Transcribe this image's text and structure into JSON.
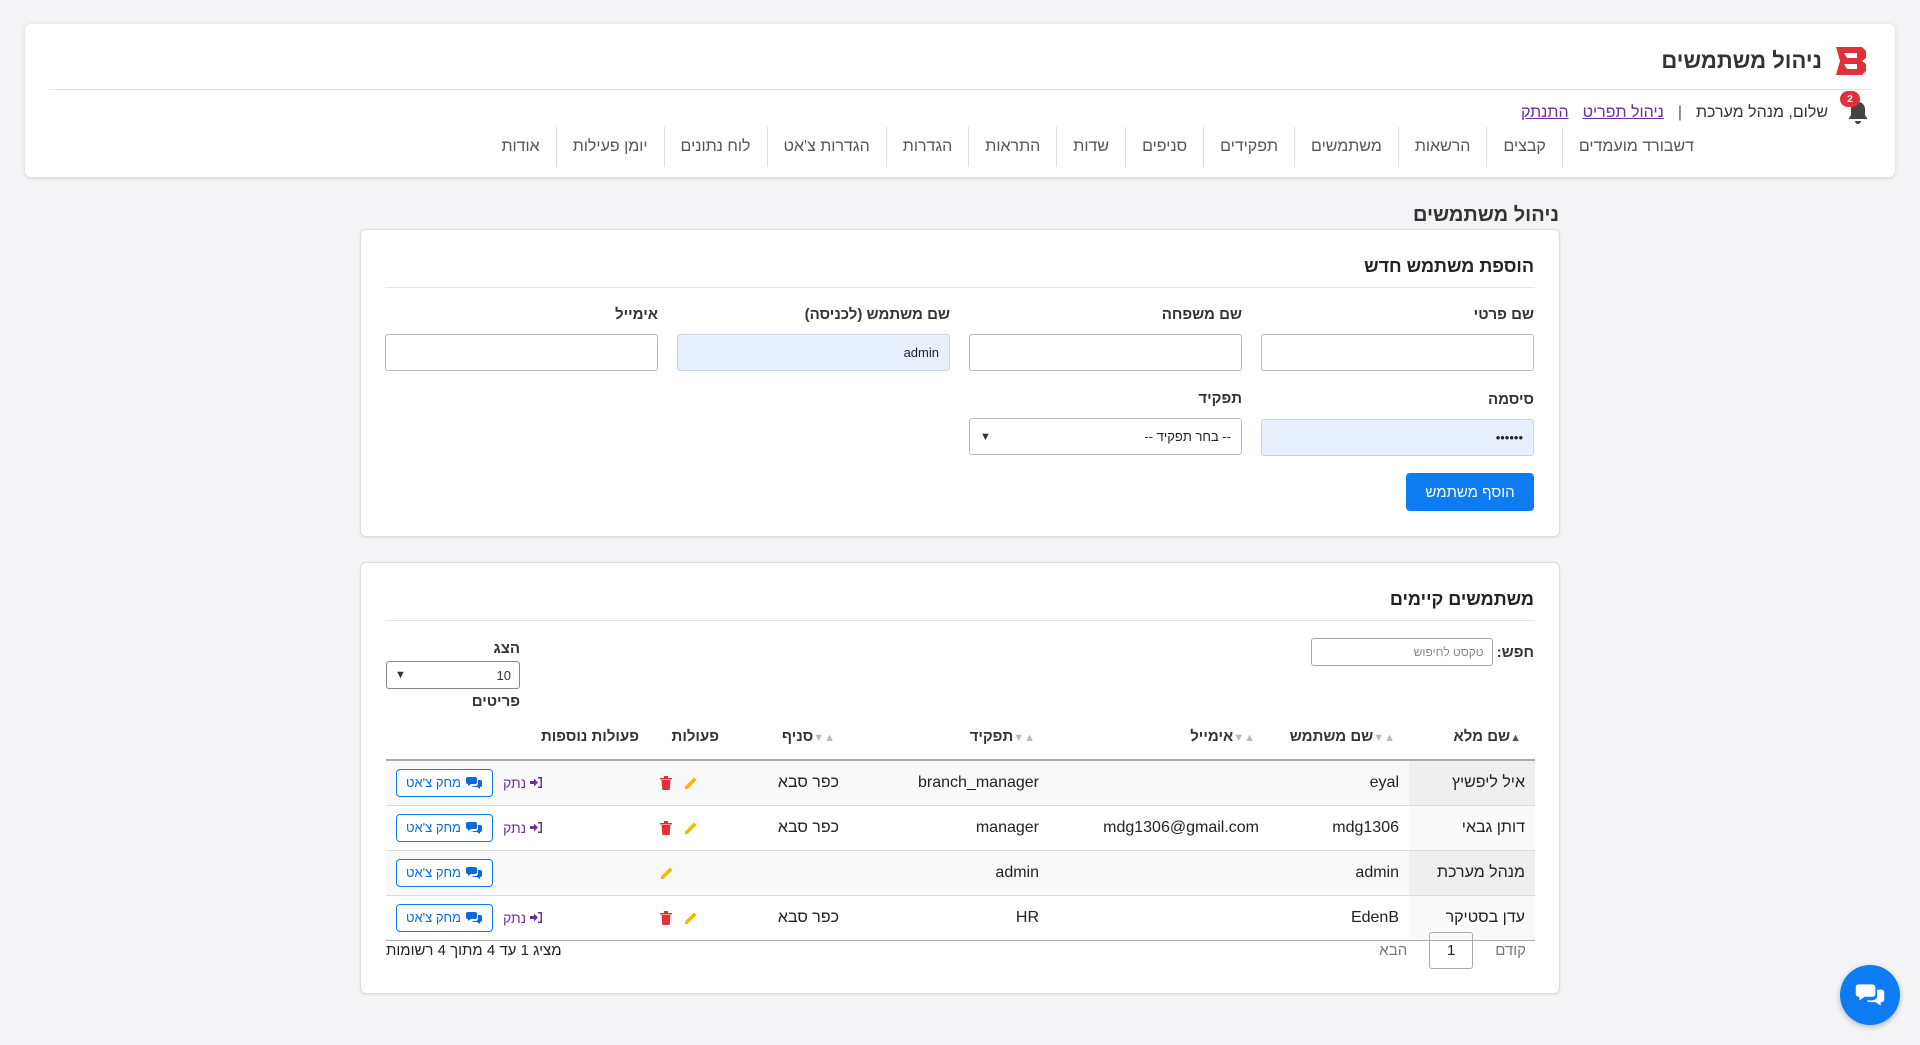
{
  "app": {
    "title": "ניהול משתמשים",
    "logo_text": "B",
    "brand_color": "#e0313b",
    "accent_color": "#0d7cf2"
  },
  "userbar": {
    "notification_count": "2",
    "greeting": "שלום, מנהל מערכת",
    "separator": "|",
    "profile_link": "ניהול תפריט",
    "logout_link": "התנתק"
  },
  "nav": {
    "items": [
      "דשבורד מועמדים",
      "קבצים",
      "הרשאות",
      "משתמשים",
      "תפקידים",
      "סניפים",
      "שדות",
      "התראות",
      "הגדרות",
      "הגדרות צ'אט",
      "לוח נתונים",
      "יומן פעילות",
      "אודות"
    ]
  },
  "page": {
    "title": "ניהול משתמשים"
  },
  "add_user": {
    "title": "הוספת משתמש חדש",
    "first_name_label": "שם פרטי",
    "first_name_value": "",
    "last_name_label": "שם משפחה",
    "last_name_value": "",
    "username_label": "שם משתמש (לכניסה)",
    "username_value": "admin",
    "email_label": "אימייל",
    "email_value": "",
    "password_label": "סיסמה",
    "password_value": "••••••",
    "role_label": "תפקיד",
    "role_value": "-- בחר תפקיד --",
    "submit_label": "הוסף משתמש"
  },
  "users": {
    "title": "משתמשים קיימים",
    "search_label": "חפש:",
    "search_placeholder": "טקסט לחיפוש",
    "length_label_top": "הצג",
    "length_value": "10",
    "length_label_bottom": "פריטים",
    "columns": {
      "full_name": "שם מלא",
      "username": "שם משתמש",
      "email": "אימייל",
      "role": "תפקיד",
      "branch": "סניף",
      "actions": "פעולות",
      "extra": "פעולות נוספות"
    },
    "rows": [
      {
        "full_name": "איל ליפשיץ",
        "username": "eyal",
        "email": "",
        "role": "branch_manager",
        "branch": "כפר סבא",
        "can_delete": true,
        "can_disconnect": true
      },
      {
        "full_name": "דותן גבאי",
        "username": "mdg1306",
        "email": "mdg1306@gmail.com",
        "role": "manager",
        "branch": "כפר סבא",
        "can_delete": true,
        "can_disconnect": true
      },
      {
        "full_name": "מנהל מערכת",
        "username": "admin",
        "email": "",
        "role": "admin",
        "branch": "",
        "can_delete": false,
        "can_disconnect": false
      },
      {
        "full_name": "עדן בסטיקר",
        "username": "EdenB",
        "email": "",
        "role": "HR",
        "branch": "כפר סבא",
        "can_delete": true,
        "can_disconnect": true
      }
    ],
    "clear_chat_label": "מחק צ'אט",
    "disconnect_label": "נתק",
    "info": "מציג 1 עד 4 מתוך 4 רשומות",
    "pager_prev": "קודם",
    "pager_current": "1",
    "pager_next": "הבא"
  }
}
